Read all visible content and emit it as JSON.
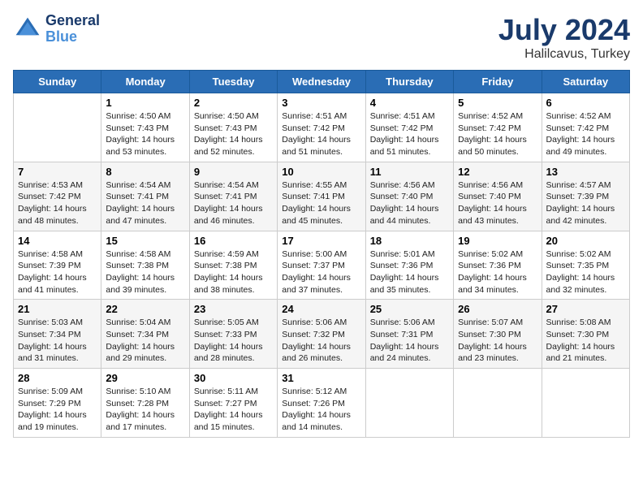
{
  "logo": {
    "line1": "General",
    "line2": "Blue"
  },
  "title": "July 2024",
  "location": "Halilcavus, Turkey",
  "days": [
    "Sunday",
    "Monday",
    "Tuesday",
    "Wednesday",
    "Thursday",
    "Friday",
    "Saturday"
  ],
  "weeks": [
    [
      {
        "date": "",
        "sunrise": "",
        "sunset": "",
        "daylight": ""
      },
      {
        "date": "1",
        "sunrise": "Sunrise: 4:50 AM",
        "sunset": "Sunset: 7:43 PM",
        "daylight": "Daylight: 14 hours and 53 minutes."
      },
      {
        "date": "2",
        "sunrise": "Sunrise: 4:50 AM",
        "sunset": "Sunset: 7:43 PM",
        "daylight": "Daylight: 14 hours and 52 minutes."
      },
      {
        "date": "3",
        "sunrise": "Sunrise: 4:51 AM",
        "sunset": "Sunset: 7:42 PM",
        "daylight": "Daylight: 14 hours and 51 minutes."
      },
      {
        "date": "4",
        "sunrise": "Sunrise: 4:51 AM",
        "sunset": "Sunset: 7:42 PM",
        "daylight": "Daylight: 14 hours and 51 minutes."
      },
      {
        "date": "5",
        "sunrise": "Sunrise: 4:52 AM",
        "sunset": "Sunset: 7:42 PM",
        "daylight": "Daylight: 14 hours and 50 minutes."
      },
      {
        "date": "6",
        "sunrise": "Sunrise: 4:52 AM",
        "sunset": "Sunset: 7:42 PM",
        "daylight": "Daylight: 14 hours and 49 minutes."
      }
    ],
    [
      {
        "date": "7",
        "sunrise": "Sunrise: 4:53 AM",
        "sunset": "Sunset: 7:42 PM",
        "daylight": "Daylight: 14 hours and 48 minutes."
      },
      {
        "date": "8",
        "sunrise": "Sunrise: 4:54 AM",
        "sunset": "Sunset: 7:41 PM",
        "daylight": "Daylight: 14 hours and 47 minutes."
      },
      {
        "date": "9",
        "sunrise": "Sunrise: 4:54 AM",
        "sunset": "Sunset: 7:41 PM",
        "daylight": "Daylight: 14 hours and 46 minutes."
      },
      {
        "date": "10",
        "sunrise": "Sunrise: 4:55 AM",
        "sunset": "Sunset: 7:41 PM",
        "daylight": "Daylight: 14 hours and 45 minutes."
      },
      {
        "date": "11",
        "sunrise": "Sunrise: 4:56 AM",
        "sunset": "Sunset: 7:40 PM",
        "daylight": "Daylight: 14 hours and 44 minutes."
      },
      {
        "date": "12",
        "sunrise": "Sunrise: 4:56 AM",
        "sunset": "Sunset: 7:40 PM",
        "daylight": "Daylight: 14 hours and 43 minutes."
      },
      {
        "date": "13",
        "sunrise": "Sunrise: 4:57 AM",
        "sunset": "Sunset: 7:39 PM",
        "daylight": "Daylight: 14 hours and 42 minutes."
      }
    ],
    [
      {
        "date": "14",
        "sunrise": "Sunrise: 4:58 AM",
        "sunset": "Sunset: 7:39 PM",
        "daylight": "Daylight: 14 hours and 41 minutes."
      },
      {
        "date": "15",
        "sunrise": "Sunrise: 4:58 AM",
        "sunset": "Sunset: 7:38 PM",
        "daylight": "Daylight: 14 hours and 39 minutes."
      },
      {
        "date": "16",
        "sunrise": "Sunrise: 4:59 AM",
        "sunset": "Sunset: 7:38 PM",
        "daylight": "Daylight: 14 hours and 38 minutes."
      },
      {
        "date": "17",
        "sunrise": "Sunrise: 5:00 AM",
        "sunset": "Sunset: 7:37 PM",
        "daylight": "Daylight: 14 hours and 37 minutes."
      },
      {
        "date": "18",
        "sunrise": "Sunrise: 5:01 AM",
        "sunset": "Sunset: 7:36 PM",
        "daylight": "Daylight: 14 hours and 35 minutes."
      },
      {
        "date": "19",
        "sunrise": "Sunrise: 5:02 AM",
        "sunset": "Sunset: 7:36 PM",
        "daylight": "Daylight: 14 hours and 34 minutes."
      },
      {
        "date": "20",
        "sunrise": "Sunrise: 5:02 AM",
        "sunset": "Sunset: 7:35 PM",
        "daylight": "Daylight: 14 hours and 32 minutes."
      }
    ],
    [
      {
        "date": "21",
        "sunrise": "Sunrise: 5:03 AM",
        "sunset": "Sunset: 7:34 PM",
        "daylight": "Daylight: 14 hours and 31 minutes."
      },
      {
        "date": "22",
        "sunrise": "Sunrise: 5:04 AM",
        "sunset": "Sunset: 7:34 PM",
        "daylight": "Daylight: 14 hours and 29 minutes."
      },
      {
        "date": "23",
        "sunrise": "Sunrise: 5:05 AM",
        "sunset": "Sunset: 7:33 PM",
        "daylight": "Daylight: 14 hours and 28 minutes."
      },
      {
        "date": "24",
        "sunrise": "Sunrise: 5:06 AM",
        "sunset": "Sunset: 7:32 PM",
        "daylight": "Daylight: 14 hours and 26 minutes."
      },
      {
        "date": "25",
        "sunrise": "Sunrise: 5:06 AM",
        "sunset": "Sunset: 7:31 PM",
        "daylight": "Daylight: 14 hours and 24 minutes."
      },
      {
        "date": "26",
        "sunrise": "Sunrise: 5:07 AM",
        "sunset": "Sunset: 7:30 PM",
        "daylight": "Daylight: 14 hours and 23 minutes."
      },
      {
        "date": "27",
        "sunrise": "Sunrise: 5:08 AM",
        "sunset": "Sunset: 7:30 PM",
        "daylight": "Daylight: 14 hours and 21 minutes."
      }
    ],
    [
      {
        "date": "28",
        "sunrise": "Sunrise: 5:09 AM",
        "sunset": "Sunset: 7:29 PM",
        "daylight": "Daylight: 14 hours and 19 minutes."
      },
      {
        "date": "29",
        "sunrise": "Sunrise: 5:10 AM",
        "sunset": "Sunset: 7:28 PM",
        "daylight": "Daylight: 14 hours and 17 minutes."
      },
      {
        "date": "30",
        "sunrise": "Sunrise: 5:11 AM",
        "sunset": "Sunset: 7:27 PM",
        "daylight": "Daylight: 14 hours and 15 minutes."
      },
      {
        "date": "31",
        "sunrise": "Sunrise: 5:12 AM",
        "sunset": "Sunset: 7:26 PM",
        "daylight": "Daylight: 14 hours and 14 minutes."
      },
      {
        "date": "",
        "sunrise": "",
        "sunset": "",
        "daylight": ""
      },
      {
        "date": "",
        "sunrise": "",
        "sunset": "",
        "daylight": ""
      },
      {
        "date": "",
        "sunrise": "",
        "sunset": "",
        "daylight": ""
      }
    ]
  ]
}
